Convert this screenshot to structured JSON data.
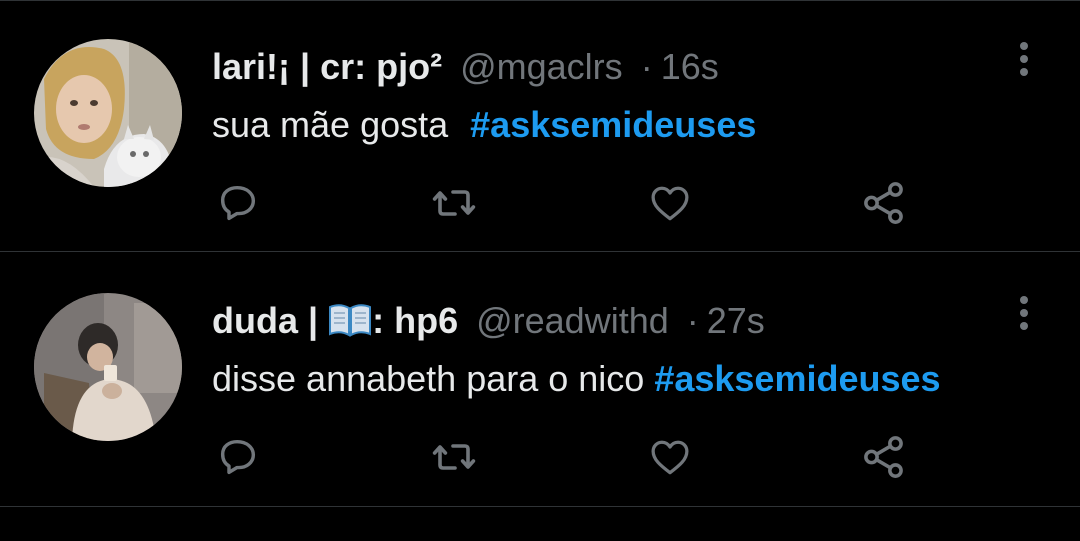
{
  "colors": {
    "background": "#000000",
    "text": "#e7e9ea",
    "muted": "#71767b",
    "link": "#1d9bf0",
    "divider": "#2f3336"
  },
  "tweets": [
    {
      "name": "lari!¡ | cr: pjo²",
      "handle": "@mgaclrs",
      "separator": "·",
      "time": "16s",
      "text": "sua mãe gosta",
      "hashtag": "#asksemideuses",
      "avatar_icon": "profile-photo-woman-with-cat"
    },
    {
      "name_prefix": "duda |",
      "name_emoji": "open-book-icon",
      "name_suffix": ": hp6",
      "handle": "@readwithd",
      "separator": "·",
      "time": "27s",
      "text": "disse annabeth para o nico",
      "hashtag": "#asksemideuses",
      "avatar_icon": "profile-photo-person-drinking"
    }
  ],
  "action_icons": [
    "reply-icon",
    "retweet-icon",
    "like-icon",
    "share-icon"
  ],
  "menu_icon": "more-options-icon"
}
